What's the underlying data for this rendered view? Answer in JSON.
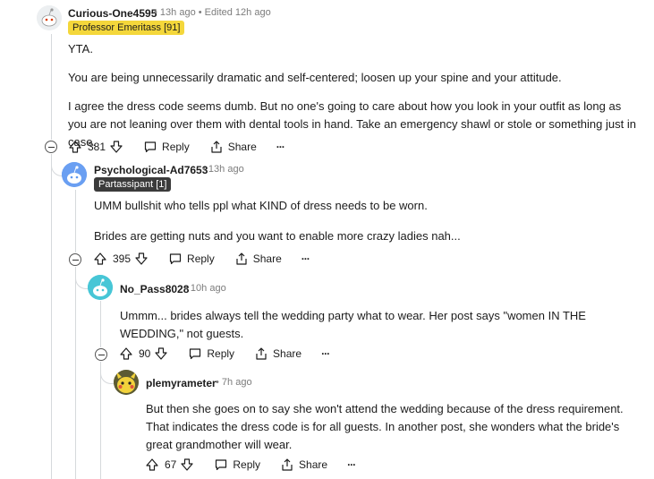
{
  "comments": [
    {
      "username": "Curious-One4595",
      "time": "13h ago",
      "edited": "Edited 12h ago",
      "flair": "Professor Emeritass [91]",
      "paragraphs": [
        "YTA.",
        "You are being unnecessarily dramatic and self-centered; loosen up your spine and your attitude.",
        " I agree the dress code seems dumb. But no one's going to care about how you look in your outfit as long as you are not leaning over them with dental tools in hand. Take an emergency shawl or stole or something just in case."
      ],
      "votes": "381"
    },
    {
      "username": "Psychological-Ad7653",
      "time": "13h ago",
      "flair": "Partassipant [1]",
      "paragraphs": [
        "UMM bullshit who tells ppl what KIND of dress needs to be worn.",
        "Brides are getting nuts and you want to enable more crazy ladies nah..."
      ],
      "votes": "395"
    },
    {
      "username": "No_Pass8028",
      "time": "10h ago",
      "paragraphs": [
        "Ummm... brides always tell the wedding party what to wear. Her post says \"women IN THE WEDDING,\" not guests."
      ],
      "votes": "90"
    },
    {
      "username": "plemyrameter",
      "time": "7h ago",
      "paragraphs": [
        "But then she goes on to say she won't attend the wedding because of the dress requirement. That indicates the dress code is for all guests. In another post, she wonders what the bride's great grandmother will wear."
      ],
      "votes": "67"
    }
  ],
  "actions": {
    "reply": "Reply",
    "share": "Share",
    "more": "···"
  },
  "separator": "•",
  "colors": {
    "flair_gold": "#f4d73b",
    "flair_dark": "#3b3b3b",
    "thread_line": "#d6d9dc",
    "meta": "#7c7c7c"
  },
  "icons": [
    "snoo-avatar-icon",
    "upvote-icon",
    "downvote-icon",
    "reply-icon",
    "share-icon",
    "more-icon",
    "collapse-icon"
  ]
}
